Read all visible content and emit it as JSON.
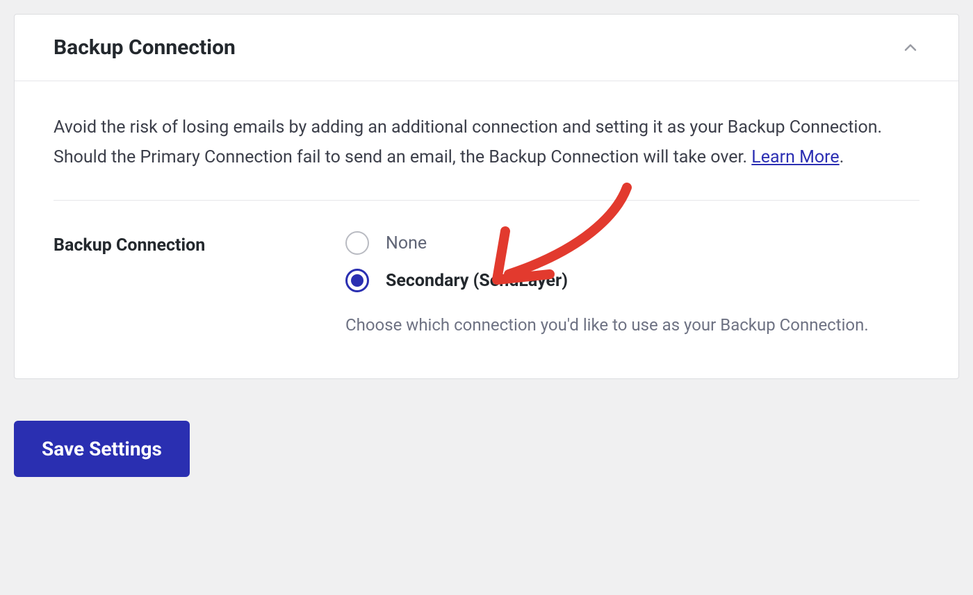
{
  "panel": {
    "title": "Backup Connection",
    "description_before_link": "Avoid the risk of losing emails by adding an additional connection and setting it as your Backup Connection. Should the Primary Connection fail to send an email, the Backup Connection will take over. ",
    "learn_more_label": "Learn More",
    "description_after_link": "."
  },
  "field": {
    "label": "Backup Connection",
    "options": [
      {
        "label": "None",
        "selected": false
      },
      {
        "label": "Secondary (SendLayer)",
        "selected": true
      }
    ],
    "help_text": "Choose which connection you'd like to use as your Backup Connection."
  },
  "buttons": {
    "save": "Save Settings"
  },
  "colors": {
    "accent": "#2a2fb1",
    "annotation": "#e23a2e"
  }
}
